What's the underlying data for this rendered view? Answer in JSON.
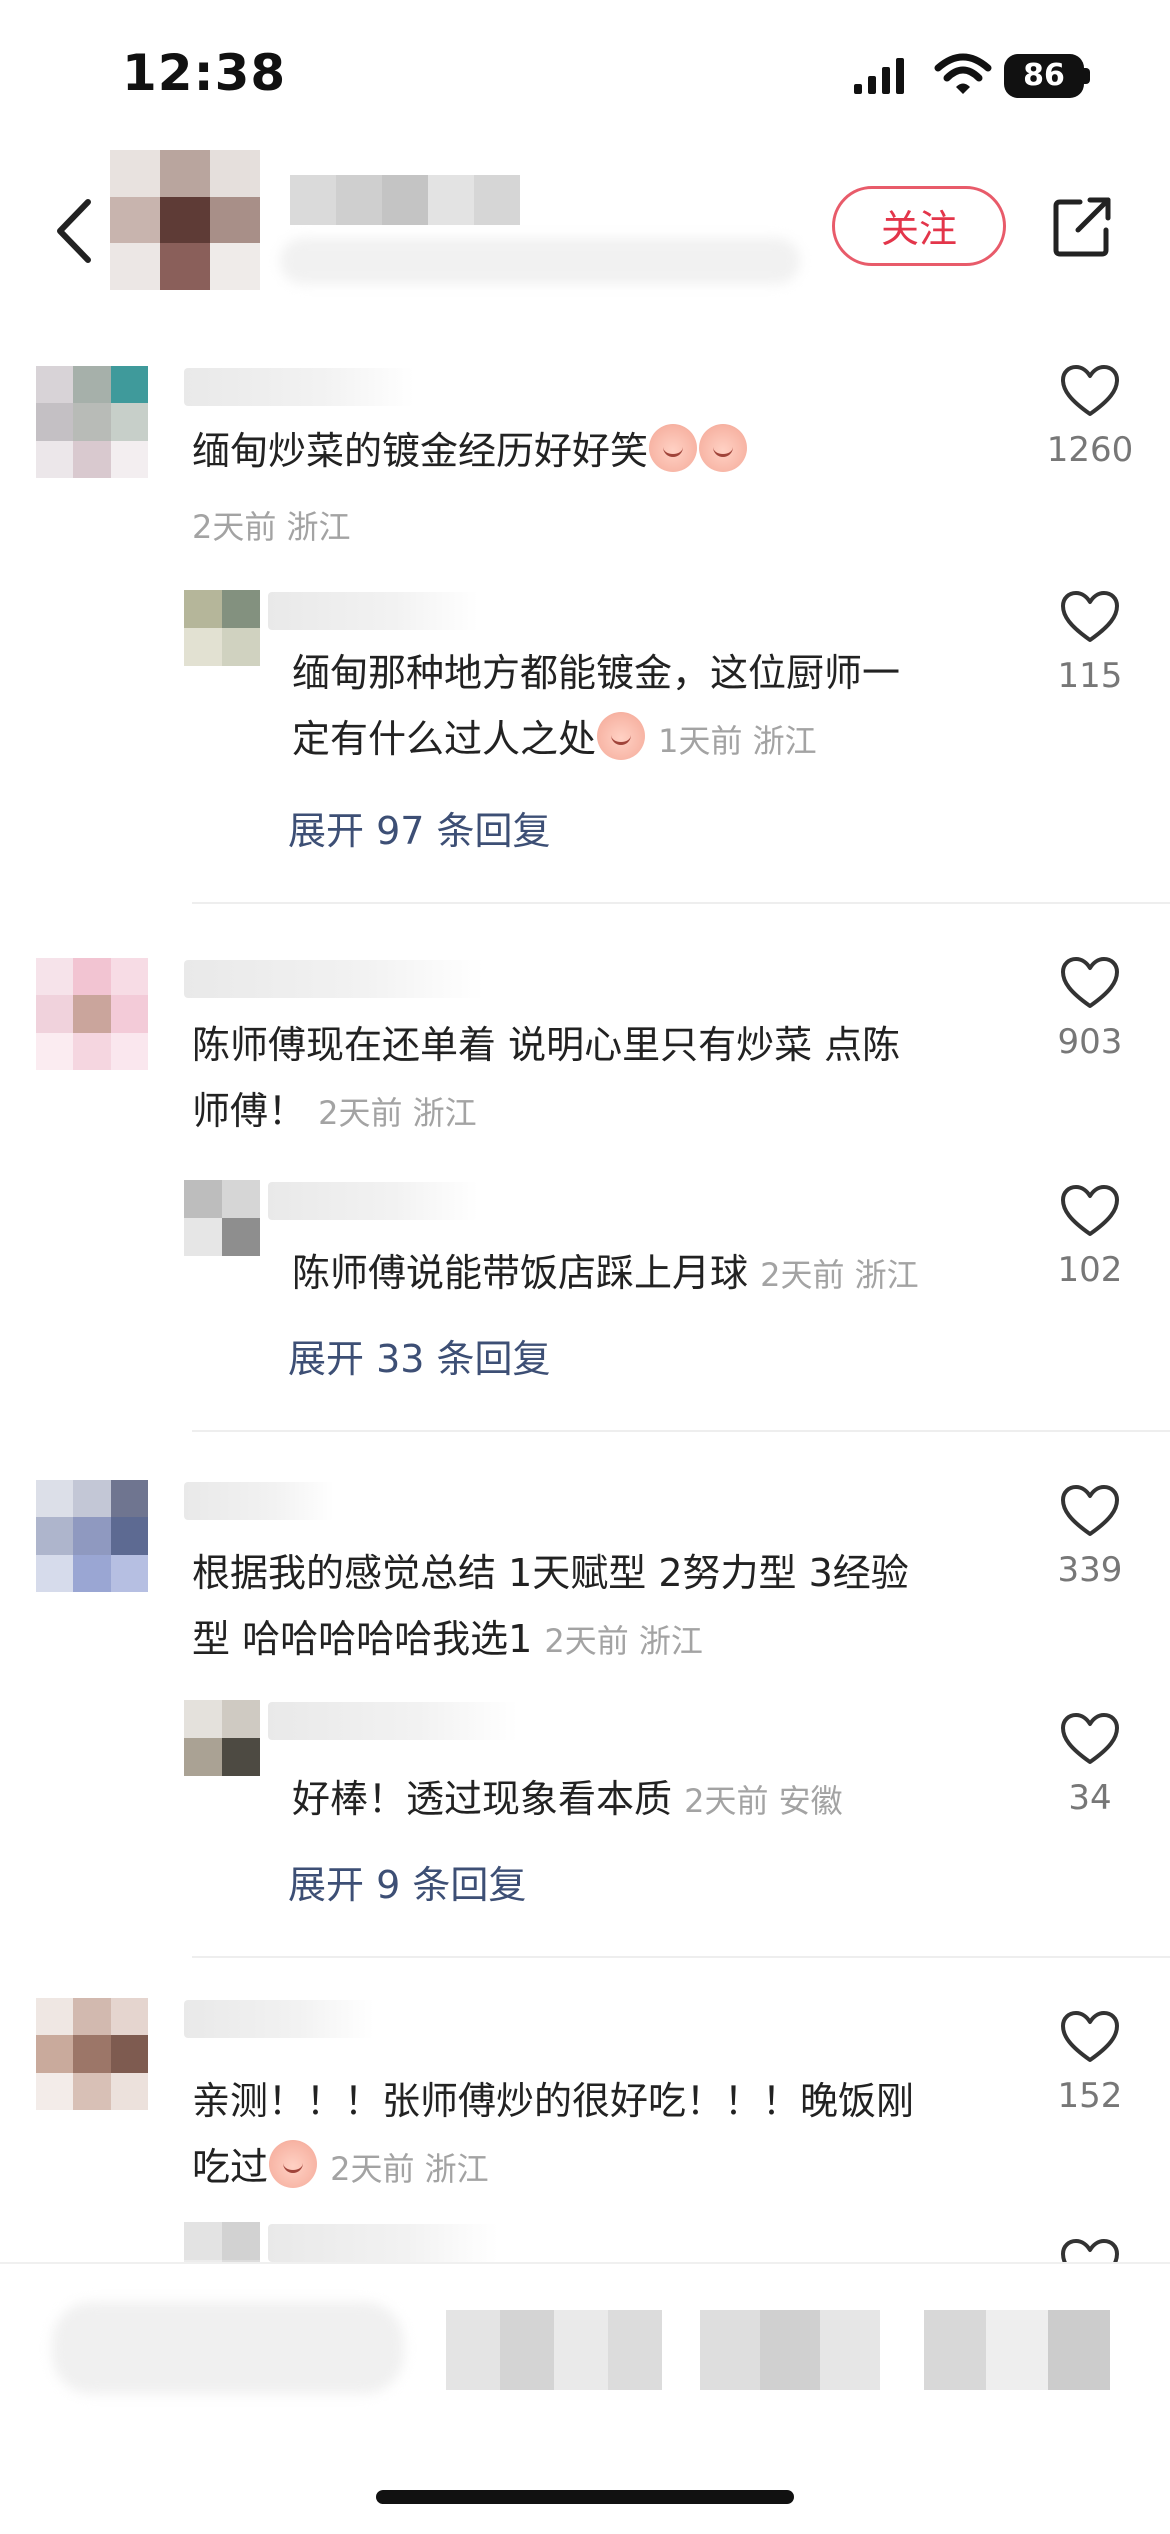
{
  "status_bar": {
    "time": "12:38",
    "battery": "86"
  },
  "header": {
    "follow_label": "关注"
  },
  "comments": [
    {
      "text_main": "缅甸炒菜的镀金经历好好笑",
      "emoji_count": 2,
      "meta": "2天前 浙江",
      "likes": "1260",
      "reply": {
        "text_line1": "缅甸那种地方都能镀金，这位厨师一",
        "text_line2": "定有什么过人之处",
        "meta": "1天前 浙江",
        "likes": "115"
      },
      "expand": "展开 97 条回复"
    },
    {
      "text_line1": "陈师傅现在还单着 说明心里只有炒菜 点陈",
      "text_line2": "师傅！",
      "meta": "2天前 浙江",
      "likes": "903",
      "reply": {
        "text": "陈师傅说能带饭店踩上月球",
        "meta": "2天前 浙江",
        "likes": "102"
      },
      "expand": "展开 33 条回复"
    },
    {
      "text_line1": "根据我的感觉总结 1天赋型 2努力型 3经验",
      "text_line2": "型 哈哈哈哈哈我选1",
      "meta": "2天前 浙江",
      "likes": "339",
      "reply": {
        "text": "好棒！透过现象看本质",
        "meta": "2天前 安徽",
        "likes": "34"
      },
      "expand": "展开 9 条回复"
    },
    {
      "text_line1": "亲测！！！张师傅炒的很好吃！！！晚饭刚",
      "text_line2": "吃过",
      "meta": "2天前 浙江",
      "likes": "152"
    }
  ],
  "colors": {
    "accent": "#e3354a",
    "link": "#3d4f75",
    "meta": "#a3a3a3"
  }
}
